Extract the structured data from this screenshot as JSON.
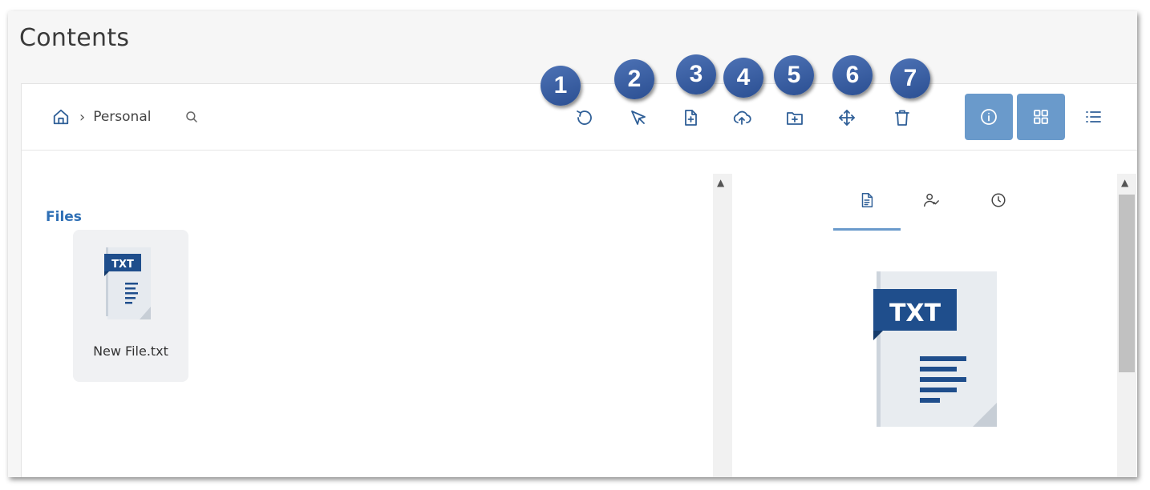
{
  "page": {
    "title": "Contents"
  },
  "breadcrumb": {
    "home_icon": "home-icon",
    "separator": "›",
    "current": "Personal",
    "search_icon": "search-icon"
  },
  "toolbar": {
    "actions": [
      {
        "name": "refresh",
        "icon": "refresh-icon",
        "badge": "1"
      },
      {
        "name": "select",
        "icon": "cursor-select-icon",
        "badge": "2"
      },
      {
        "name": "new-file",
        "icon": "new-file-icon",
        "badge": "3"
      },
      {
        "name": "upload",
        "icon": "cloud-upload-icon",
        "badge": "4"
      },
      {
        "name": "new-folder",
        "icon": "new-folder-icon",
        "badge": "5"
      },
      {
        "name": "move",
        "icon": "move-icon",
        "badge": "6"
      },
      {
        "name": "delete",
        "icon": "trash-icon",
        "badge": "7"
      }
    ],
    "view_buttons": [
      {
        "name": "info",
        "icon": "info-icon",
        "active": true
      },
      {
        "name": "grid",
        "icon": "grid-icon",
        "active": true
      },
      {
        "name": "list",
        "icon": "list-icon",
        "active": false
      }
    ]
  },
  "files_section": {
    "label": "Files",
    "items": [
      {
        "name": "New File.txt",
        "type_label": "TXT"
      }
    ]
  },
  "details_pane": {
    "tabs": [
      {
        "name": "details",
        "icon": "document-icon",
        "active": true
      },
      {
        "name": "sharing",
        "icon": "user-check-icon",
        "active": false
      },
      {
        "name": "history",
        "icon": "clock-icon",
        "active": false
      }
    ],
    "preview_type_label": "TXT"
  },
  "colors": {
    "accent": "#2f5f97",
    "active_button": "#6a9acb",
    "badge": "#3b5fa3",
    "file_label": "#1f4e8c"
  }
}
